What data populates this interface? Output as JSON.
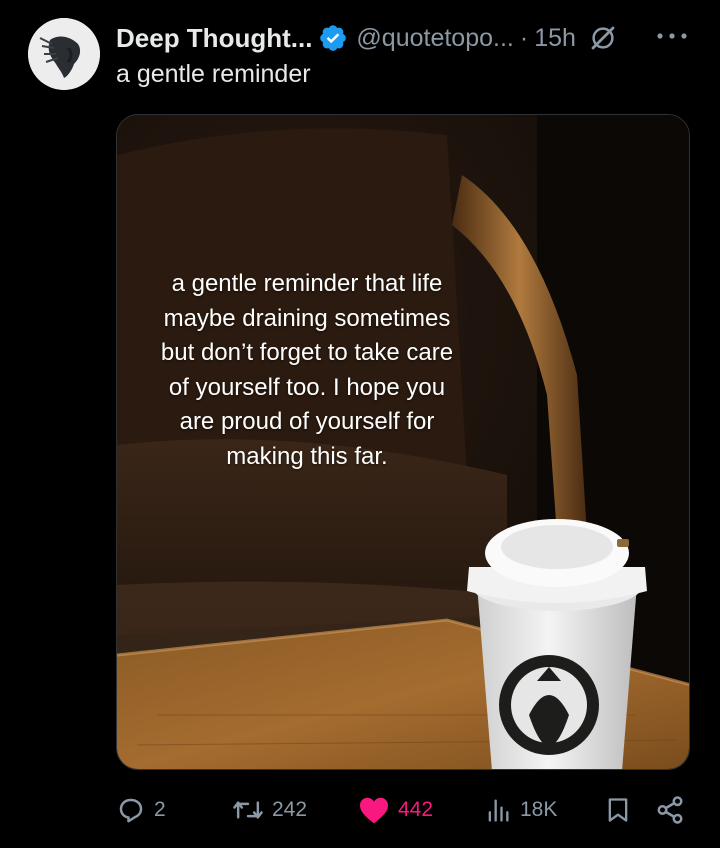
{
  "post": {
    "author_name": "Deep Thought...",
    "handle": "@quotetopo...",
    "separator": "·",
    "time": "15h",
    "text": "a gentle reminder",
    "image_text": "a gentle reminder that life maybe draining sometimes but don’t forget to take care of yourself too. I hope you are proud of yourself for making this far."
  },
  "actions": {
    "replies": "2",
    "reposts": "242",
    "likes": "442",
    "views": "18K"
  },
  "colors": {
    "background": "#000000",
    "text": "#e7e9ea",
    "muted": "#8b98a5",
    "verified": "#1d9bf0",
    "like": "#f91880"
  },
  "icons": [
    "verified-badge-icon",
    "grok-icon",
    "more-icon",
    "reply-icon",
    "repost-icon",
    "like-icon",
    "views-icon",
    "bookmark-icon",
    "share-icon"
  ]
}
